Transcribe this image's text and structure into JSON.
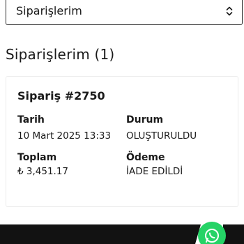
{
  "select": {
    "value": "Siparişlerim"
  },
  "heading": "Siparişlerim (1)",
  "order": {
    "title": "Sipariş #2750",
    "date_label": "Tarih",
    "date_value": "10 Mart 2025 13:33",
    "status_label": "Durum",
    "status_value": "OLUŞTURULDU",
    "total_label": "Toplam",
    "total_value": "₺ 3,451.17",
    "payment_label": "Ödeme",
    "payment_value": "İADE EDİLDİ"
  },
  "icons": {
    "chevron": "chevron-up-down-icon",
    "chat": "whatsapp-icon"
  },
  "colors": {
    "footer": "#121212",
    "whatsapp": "#25d366"
  }
}
